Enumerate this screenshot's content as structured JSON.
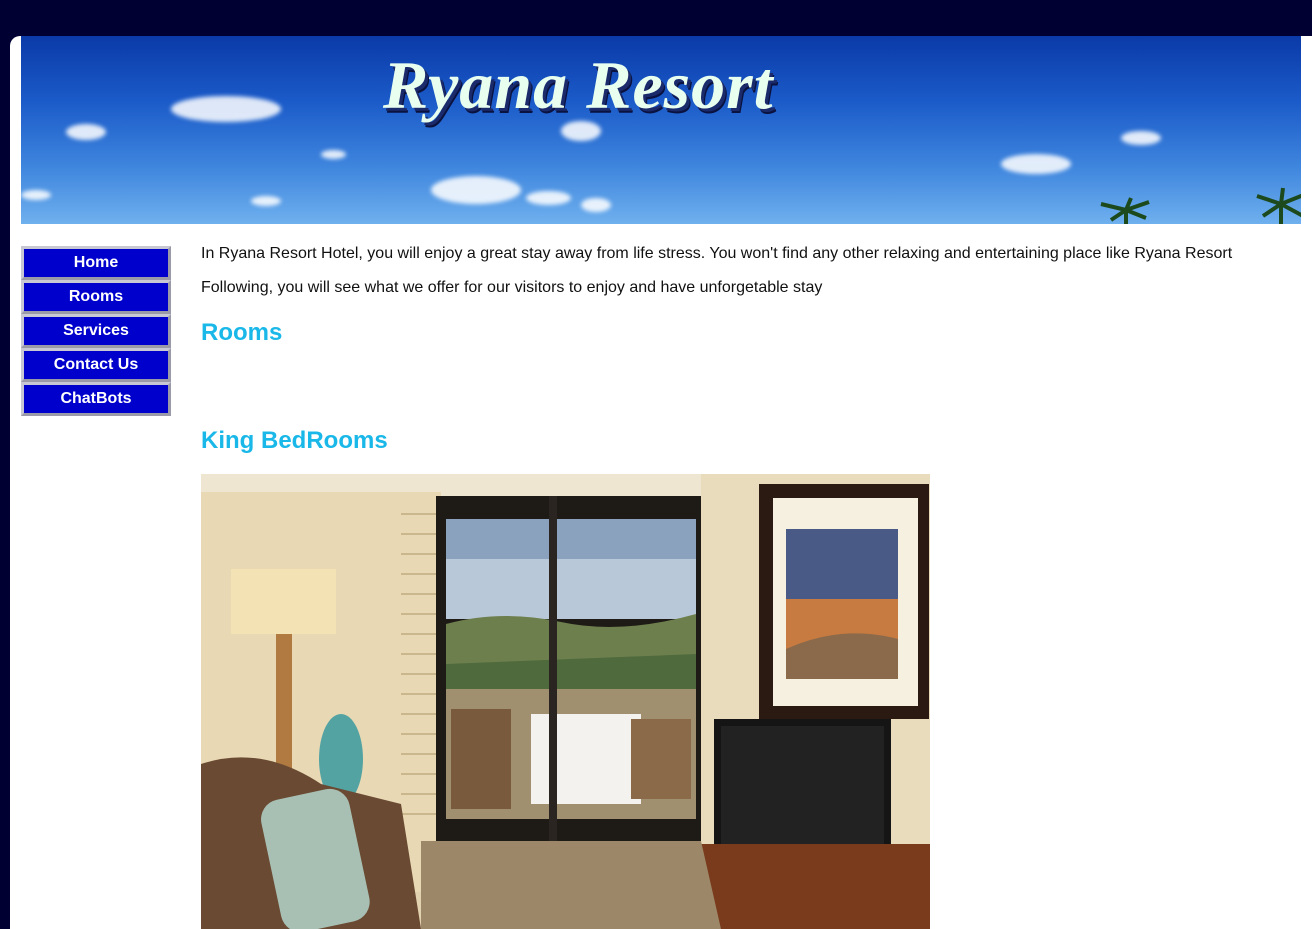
{
  "banner": {
    "title": "Ryana Resort"
  },
  "nav": {
    "items": [
      {
        "label": "Home"
      },
      {
        "label": "Rooms"
      },
      {
        "label": "Services"
      },
      {
        "label": "Contact Us"
      },
      {
        "label": "ChatBots"
      }
    ]
  },
  "main": {
    "intro": "In Ryana Resort Hotel, you will enjoy a great stay away from life stress. You won't find any other relaxing and entertaining place like Ryana Resort",
    "following": "Following, you will see what we offer for our visitors to enjoy and have unforgetable stay",
    "rooms_heading": "Rooms",
    "king_heading": "King BedRooms"
  },
  "colors": {
    "page_background": "#000033",
    "nav_button": "#0000cc",
    "heading": "#1ab8e8"
  }
}
